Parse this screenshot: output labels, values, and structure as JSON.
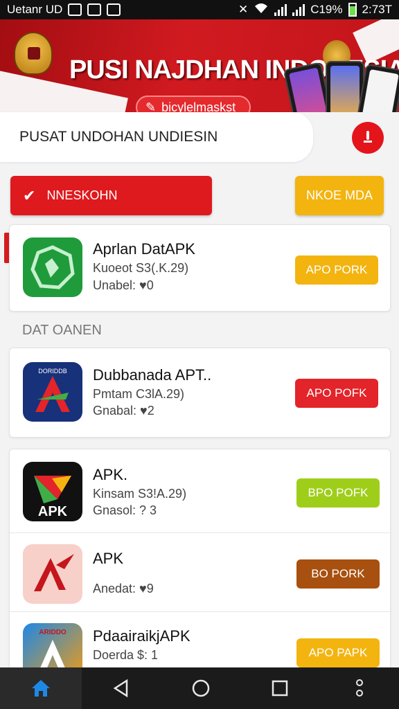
{
  "status_bar": {
    "carrier": "Uetanr UD",
    "battery_percent": "C19%",
    "time": "2:73T"
  },
  "header": {
    "title": "PUSI NAJDHAN INDONESIA",
    "pill_label": "bicylelmaskst"
  },
  "search": {
    "value": "PUSAT UNDOHAN UNDIESIN"
  },
  "actions": {
    "primary_label": "NNESKOHN",
    "secondary_label": "NKOE MDA"
  },
  "featured": {
    "name": "Aprlan DatAPK",
    "meta": "Kuoeot S3(.K.29)",
    "rating": "Unabel: ♥0",
    "button": "APO PORK"
  },
  "section": {
    "title": "DAT OANEN"
  },
  "apps": [
    {
      "name": "Dubbanada APT..",
      "meta": "Pmtam C3lA.29)",
      "rating": "Gnabal: ♥2",
      "button": "APO POFK"
    },
    {
      "name": "APK.",
      "meta": "Kinsam S3!A.29)",
      "rating": "Gnasol: ? 3",
      "button": "BPO POFK"
    },
    {
      "name": "APK",
      "meta": "",
      "rating": "Anedat: ♥9",
      "button": "BO PORK"
    },
    {
      "name": "PdaairaikjAPK",
      "meta": "Doerda $: 1",
      "rating": "",
      "button": "APO PAPK"
    }
  ],
  "icon_labels": {
    "corner_badge": "DORIDDB",
    "apk_logo": "APK",
    "circle_badge": "ARIDDO"
  },
  "colors": {
    "brand_red": "#de1a1e",
    "accent_yellow": "#f3b410",
    "btn_red": "#e3242a",
    "btn_lime": "#9fce1a",
    "btn_brown": "#a8500f"
  }
}
